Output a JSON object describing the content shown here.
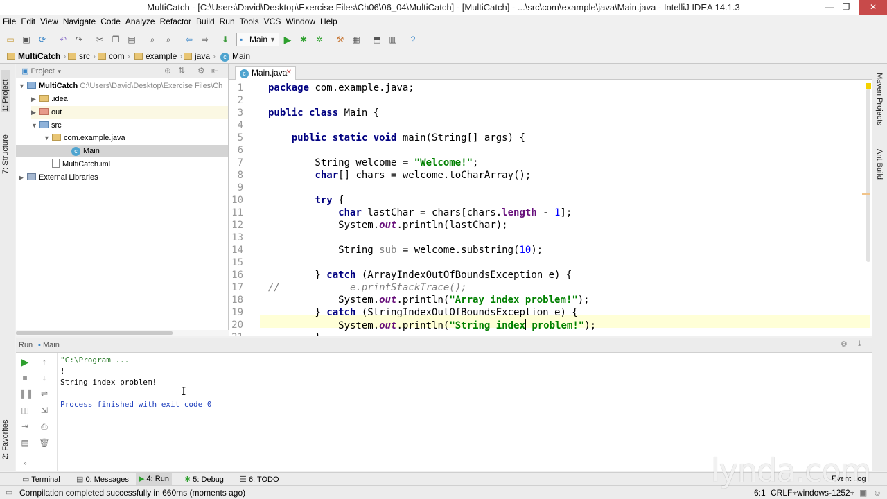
{
  "window": {
    "title": "MultiCatch - [C:\\Users\\David\\Desktop\\Exercise Files\\Ch06\\06_04\\MultiCatch] - [MultiCatch] - ...\\src\\com\\example\\java\\Main.java - IntelliJ IDEA 14.1.3"
  },
  "menu": [
    "File",
    "Edit",
    "View",
    "Navigate",
    "Code",
    "Analyze",
    "Refactor",
    "Build",
    "Run",
    "Tools",
    "VCS",
    "Window",
    "Help"
  ],
  "toolbar": {
    "run_config": "Main"
  },
  "breadcrumb": [
    "MultiCatch",
    "src",
    "com",
    "example",
    "java",
    "Main"
  ],
  "left_strip": {
    "project": "1: Project",
    "structure": "7: Structure",
    "favorites": "2: Favorites"
  },
  "right_strip": {
    "maven": "Maven Projects",
    "ant": "Ant Build"
  },
  "project": {
    "header": "Project",
    "root_name": "MultiCatch",
    "root_path": "C:\\Users\\David\\Desktop\\Exercise Files\\Ch",
    "items": [
      ".idea",
      "out",
      "src",
      "com.example.java",
      "Main",
      "MultiCatch.iml",
      "External Libraries"
    ]
  },
  "editor": {
    "tab": "Main.java",
    "line_numbers": [
      "1",
      "2",
      "3",
      "4",
      "5",
      "6",
      "7",
      "8",
      "9",
      "10",
      "11",
      "12",
      "13",
      "14",
      "15",
      "16",
      "17",
      "18",
      "19",
      "20",
      "21"
    ]
  },
  "run": {
    "header_label": "Run",
    "header_config": "Main",
    "console": [
      "\"C:\\Program ...",
      "!",
      "String index problem!",
      "",
      "Process finished with exit code 0"
    ]
  },
  "bottom_tabs": [
    "Terminal",
    "0: Messages",
    "4: Run",
    "5: Debug",
    "6: TODO"
  ],
  "event_log": "Event Log",
  "status": {
    "message": "Compilation completed successfully in 660ms (moments ago)",
    "position": "6:1",
    "line_sep": "CRLF÷",
    "encoding": "windows-1252÷"
  },
  "watermark": "lynda.com",
  "colors": {
    "keyword": "#000080",
    "string": "#008000",
    "field": "#660e7a",
    "number": "#0000ff",
    "comment": "#808080",
    "current_line": "#ffffd7",
    "run_green": "#2ea02e"
  }
}
